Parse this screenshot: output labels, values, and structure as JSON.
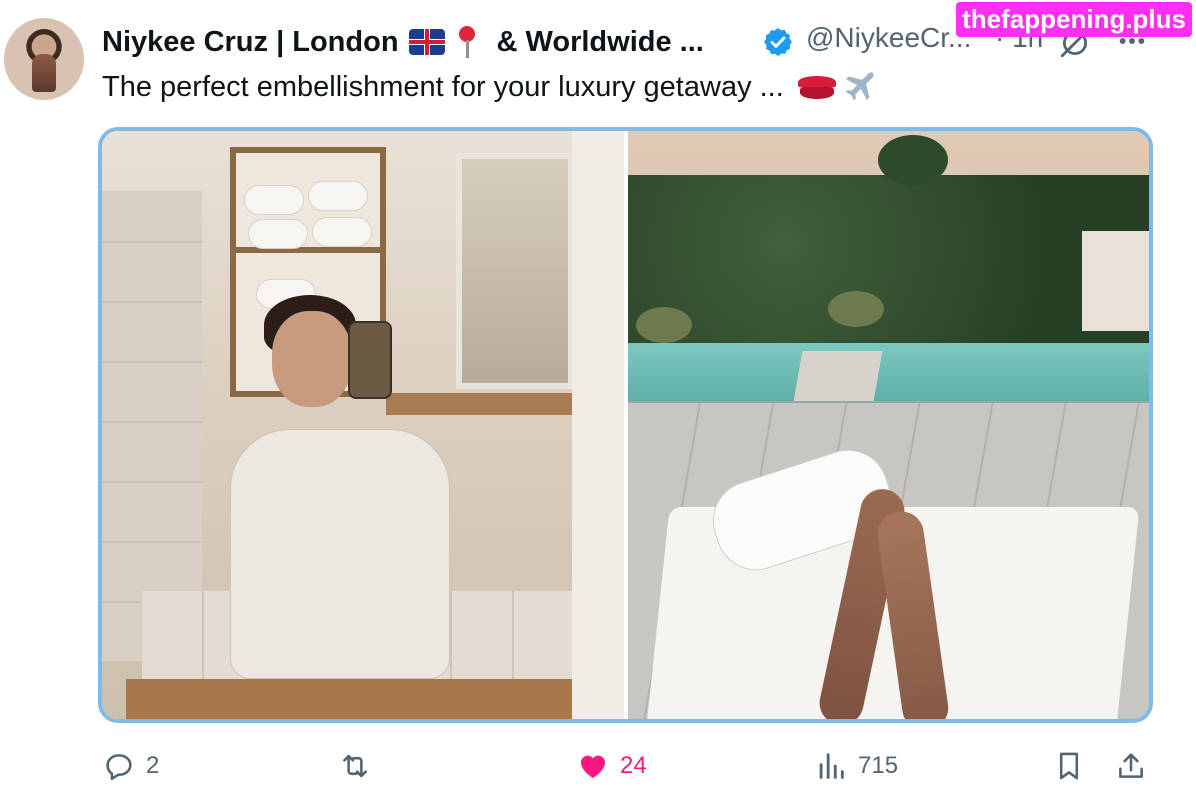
{
  "author": {
    "display_name": "Niykee Cruz | London",
    "name_suffix": "& Worldwide ...",
    "flag_icon": "uk-flag-icon",
    "pin_icon": "round-pushpin-icon",
    "verified": true,
    "handle": "@NiykeeCr...",
    "time": "· 1h"
  },
  "watermark": "thefappening.plus",
  "tweet": {
    "text": "The perfect embellishment for your luxury getaway ...",
    "emojis": [
      "lips-icon",
      "airplane-icon"
    ]
  },
  "media": {
    "count": 2
  },
  "actions": {
    "replies": "2",
    "reposts": "",
    "likes": "24",
    "views": "715",
    "liked": true,
    "like_color": "#f91880",
    "accent_color": "#1d9bf0",
    "muted_color": "#536471"
  }
}
